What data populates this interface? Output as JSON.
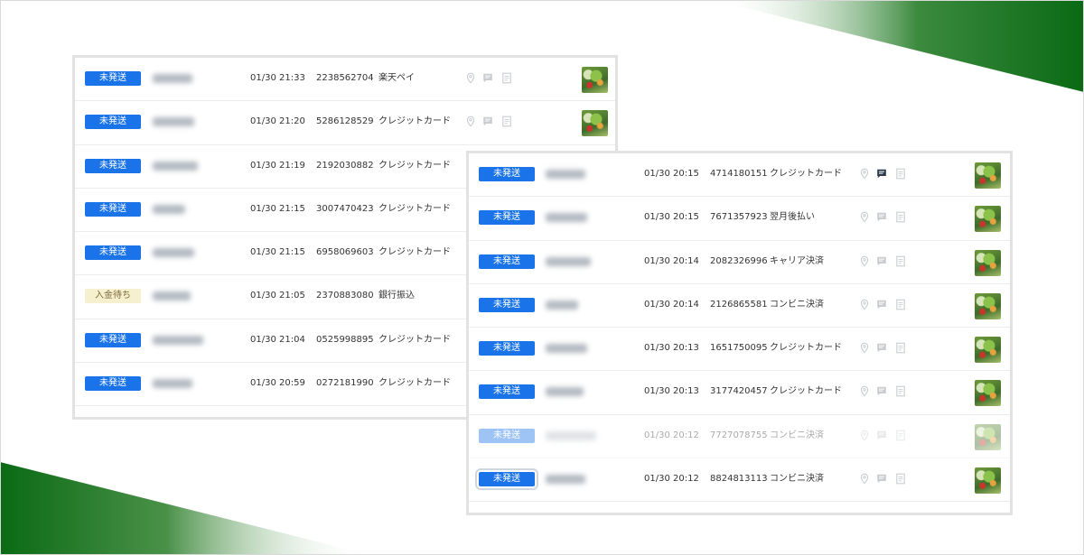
{
  "colors": {
    "badge_blue": "#1a73e8",
    "badge_pending_bg": "#f7f0cf",
    "accent_green": "#0a6a14",
    "icon_active": "#2b3a4a",
    "icon_muted": "#c9ccd1"
  },
  "orders_panel_back": {
    "rows": [
      {
        "status": "未発送",
        "status_kind": "unshipped",
        "date": "01/30 21:33",
        "order_id": "2238562704",
        "payment": "楽天ペイ"
      },
      {
        "status": "未発送",
        "status_kind": "unshipped",
        "date": "01/30 21:20",
        "order_id": "5286128529",
        "payment": "クレジットカード"
      },
      {
        "status": "未発送",
        "status_kind": "unshipped",
        "date": "01/30 21:19",
        "order_id": "2192030882",
        "payment": "クレジットカード"
      },
      {
        "status": "未発送",
        "status_kind": "unshipped",
        "date": "01/30 21:15",
        "order_id": "3007470423",
        "payment": "クレジットカード"
      },
      {
        "status": "未発送",
        "status_kind": "unshipped",
        "date": "01/30 21:15",
        "order_id": "6958069603",
        "payment": "クレジットカード"
      },
      {
        "status": "入金待ち",
        "status_kind": "pending",
        "date": "01/30 21:05",
        "order_id": "2370883080",
        "payment": "銀行振込"
      },
      {
        "status": "未発送",
        "status_kind": "unshipped",
        "date": "01/30 21:04",
        "order_id": "0525998895",
        "payment": "クレジットカード"
      },
      {
        "status": "未発送",
        "status_kind": "unshipped",
        "date": "01/30 20:59",
        "order_id": "0272181990",
        "payment": "クレジットカード"
      }
    ]
  },
  "orders_panel_front": {
    "rows": [
      {
        "status": "未発送",
        "status_kind": "unshipped",
        "date": "01/30 20:15",
        "order_id": "4714180151",
        "payment": "クレジットカード",
        "message_active": true
      },
      {
        "status": "未発送",
        "status_kind": "unshipped",
        "date": "01/30 20:15",
        "order_id": "7671357923",
        "payment": "翌月後払い"
      },
      {
        "status": "未発送",
        "status_kind": "unshipped",
        "date": "01/30 20:14",
        "order_id": "2082326996",
        "payment": "キャリア決済"
      },
      {
        "status": "未発送",
        "status_kind": "unshipped",
        "date": "01/30 20:14",
        "order_id": "2126865581",
        "payment": "コンビニ決済"
      },
      {
        "status": "未発送",
        "status_kind": "unshipped",
        "date": "01/30 20:13",
        "order_id": "1651750095",
        "payment": "クレジットカード"
      },
      {
        "status": "未発送",
        "status_kind": "unshipped",
        "date": "01/30 20:13",
        "order_id": "3177420457",
        "payment": "クレジットカード"
      },
      {
        "status": "未発送",
        "status_kind": "unshipped",
        "date": "01/30 20:12",
        "order_id": "7727078755",
        "payment": "コンビニ決済",
        "faded": true
      },
      {
        "status": "未発送",
        "status_kind": "unshipped",
        "date": "01/30 20:12",
        "order_id": "8824813113",
        "payment": "コンビニ決済",
        "focused": true
      }
    ]
  },
  "row_icons": [
    "location-pin-icon",
    "message-icon",
    "document-icon"
  ],
  "product_thumbnail": "vegetable-product-thumbnail"
}
